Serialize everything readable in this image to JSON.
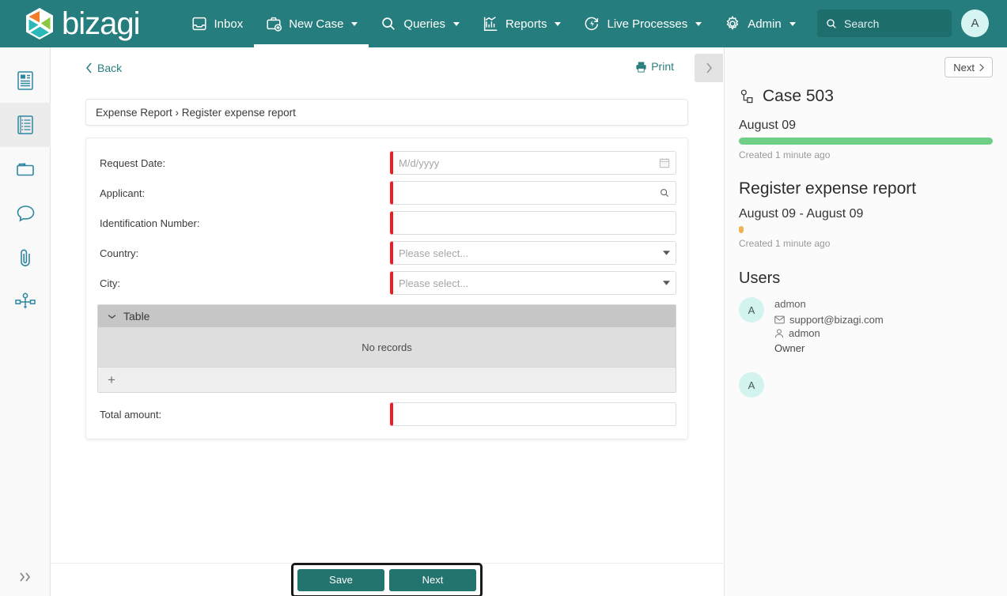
{
  "header": {
    "brand": "bizagi",
    "brand_icon": "bizagi-hexagon-logo",
    "nav": [
      {
        "label": "Inbox",
        "icon": "inbox-icon",
        "caret": false,
        "active": false
      },
      {
        "label": "New Case",
        "icon": "briefcase-plus-icon",
        "caret": true,
        "active": true
      },
      {
        "label": "Queries",
        "icon": "search-icon",
        "caret": true,
        "active": false
      },
      {
        "label": "Reports",
        "icon": "chart-icon",
        "caret": true,
        "active": false
      },
      {
        "label": "Live Processes",
        "icon": "live-process-icon",
        "caret": true,
        "active": false
      },
      {
        "label": "Admin",
        "icon": "gear-icon",
        "caret": true,
        "active": false
      }
    ],
    "search": {
      "placeholder": "Search",
      "value": "",
      "icon": "search-icon"
    },
    "avatar": {
      "initial": "A"
    }
  },
  "sidebar": {
    "items": [
      {
        "name": "summary",
        "icon": "case-summary-icon",
        "active": false
      },
      {
        "name": "forms",
        "icon": "form-list-icon",
        "active": true
      },
      {
        "name": "documents",
        "icon": "folder-icon",
        "active": false
      },
      {
        "name": "comments",
        "icon": "comment-bubble-icon",
        "active": false
      },
      {
        "name": "attachments",
        "icon": "paperclip-icon",
        "active": false
      },
      {
        "name": "process-diagram",
        "icon": "workflow-icon",
        "active": false
      }
    ],
    "expand": {
      "icon": "double-chevron-right-icon"
    }
  },
  "toolbar": {
    "back_label": "Back",
    "back_icon": "chevron-left-icon",
    "print_label": "Print",
    "print_icon": "printer-icon",
    "collapse_icon": "chevron-right-icon"
  },
  "breadcrumb": {
    "text": "Expense Report › Register expense report"
  },
  "form": {
    "fields": [
      {
        "label": "Request Date:",
        "type": "date",
        "value": "",
        "placeholder": "M/d/yyyy",
        "required": true,
        "icon": "calendar-icon"
      },
      {
        "label": "Applicant:",
        "type": "lookup",
        "value": "",
        "placeholder": "",
        "required": true,
        "icon": "search-icon"
      },
      {
        "label": "Identification Number:",
        "type": "text",
        "value": "",
        "placeholder": "",
        "required": true,
        "icon": ""
      },
      {
        "label": "Country:",
        "type": "select",
        "value": "Please select...",
        "placeholder": "Please select...",
        "required": true,
        "icon": "chevron-down-icon"
      },
      {
        "label": "City:",
        "type": "select",
        "value": "Please select...",
        "placeholder": "Please select...",
        "required": true,
        "icon": "chevron-down-icon"
      }
    ],
    "table": {
      "title": "Table",
      "toggle_icon": "chevron-down-icon",
      "empty_text": "No records",
      "add_label": "+"
    },
    "total": {
      "label": "Total amount:",
      "value": "",
      "placeholder": "",
      "required": true
    }
  },
  "right_panel": {
    "next_label": "Next",
    "next_icon": "chevron-right-icon",
    "case": {
      "title": "Case 503",
      "icon": "case-node-icon",
      "date": "August 09",
      "progress_color": "#6fcf87",
      "created": "Created 1 minute ago"
    },
    "activity": {
      "title": "Register expense report",
      "date_range": "August 09 - August 09",
      "progress_color": "#efb354",
      "created": "Created 1 minute ago"
    },
    "users_title": "Users",
    "users": [
      {
        "initial": "A",
        "name": "admon",
        "email": "support@bizagi.com",
        "email_icon": "envelope-icon",
        "username": "admon",
        "username_icon": "person-icon",
        "role": "Owner"
      },
      {
        "initial": "A",
        "name": "",
        "email": "",
        "email_icon": "",
        "username": "",
        "username_icon": "",
        "role": ""
      }
    ]
  },
  "footer": {
    "save_label": "Save",
    "next_label": "Next"
  },
  "colors": {
    "brand_teal": "#257e7d",
    "accent_teal": "#23736f",
    "required_red": "#ee1c25",
    "progress_green": "#6fcf87",
    "progress_orange": "#efb354"
  }
}
